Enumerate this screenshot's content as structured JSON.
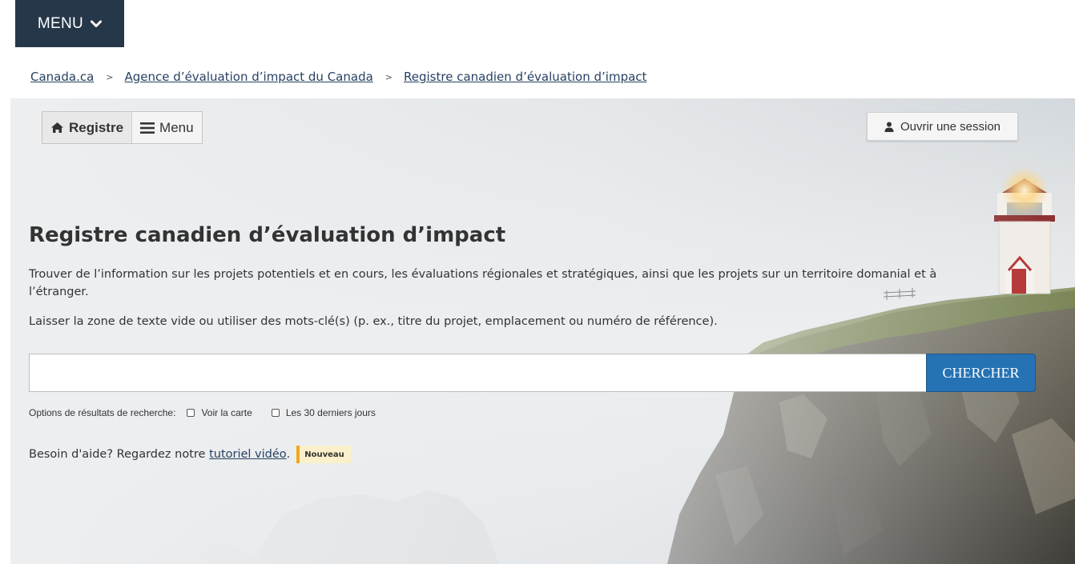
{
  "top_menu": {
    "label": "MENU"
  },
  "breadcrumb": {
    "items": [
      "Canada.ca",
      "Agence d’évaluation d’impact du Canada",
      "Registre canadien d’évaluation d’impact"
    ],
    "separator": ">"
  },
  "toolbar": {
    "registre_label": "Registre",
    "menu_label": "Menu"
  },
  "login": {
    "label": "Ouvrir une session"
  },
  "hero": {
    "title": "Registre canadien d’évaluation d’impact",
    "description": "Trouver de l’information sur les projets potentiels et en cours, les évaluations régionales et stratégiques, ainsi que les projets sur un territoire domanial et à l’étranger.",
    "hint": "Laisser la zone de texte vide ou utiliser des mots-clé(s) (p. ex., titre du projet, emplacement ou numéro de référence)."
  },
  "search": {
    "value": "",
    "button_label": "CHERCHER"
  },
  "options": {
    "label": "Options de résultats de recherche:",
    "items": [
      "Voir la carte",
      "Les 30 derniers jours"
    ]
  },
  "help": {
    "text": "Besoin d'aide? Regardez notre",
    "link": "tutoriel vidéo",
    "period": ".",
    "badge": "Nouveau"
  },
  "colors": {
    "top_menu_bg": "#26374a",
    "link": "#284162",
    "search_button": "#2572b4",
    "badge_bg": "#fbf0c9",
    "badge_border": "#f0a81c"
  }
}
